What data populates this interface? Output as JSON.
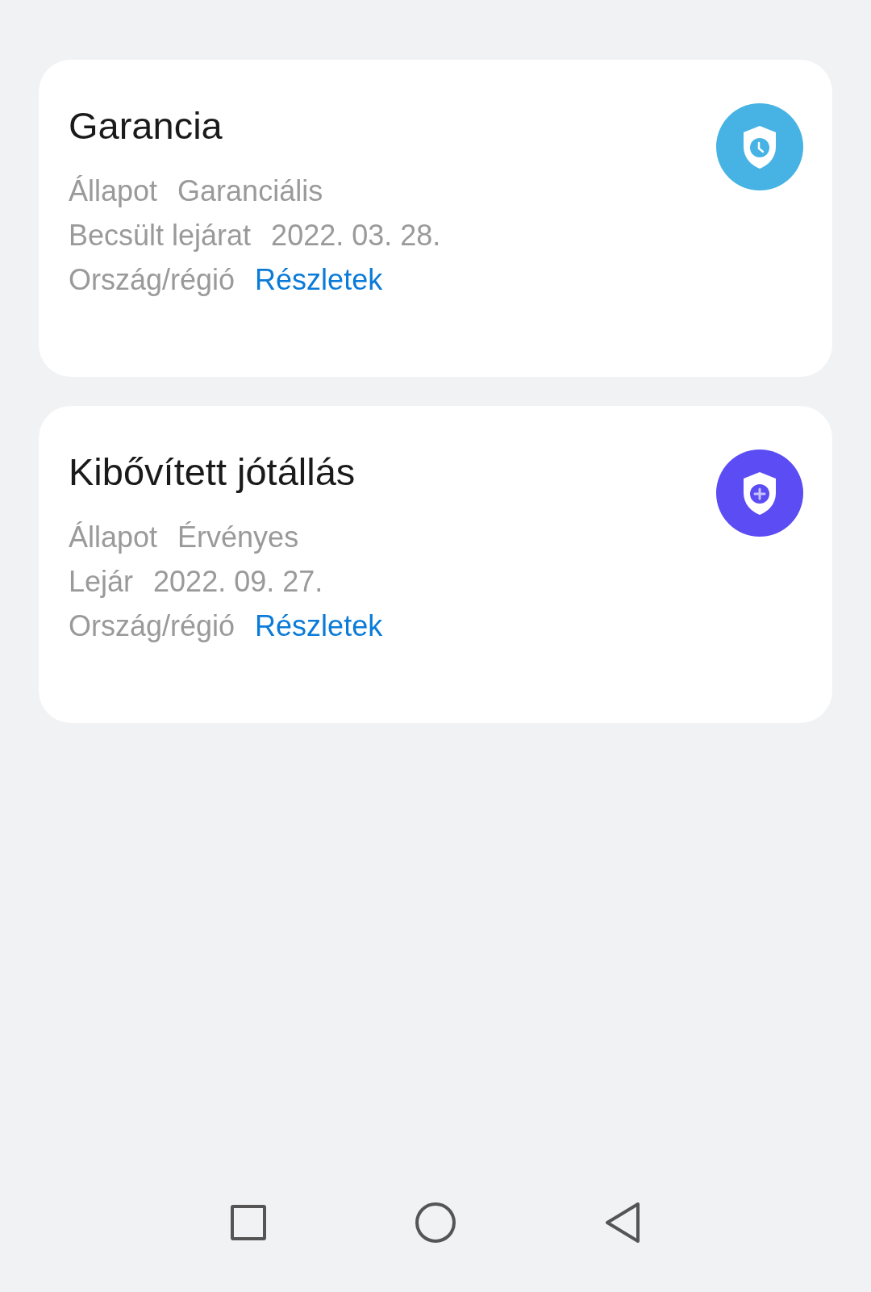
{
  "cards": [
    {
      "title": "Garancia",
      "kind": "clock",
      "color": "#47b3e4",
      "rows": [
        {
          "label": "Állapot",
          "value": "Garanciális",
          "kind": "text"
        },
        {
          "label": "Becsült lejárat",
          "value": "2022. 03. 28.",
          "kind": "text"
        },
        {
          "label": "Ország/régió",
          "value": "Részletek",
          "kind": "link"
        }
      ]
    },
    {
      "title": "Kibővített jótállás",
      "kind": "plus",
      "color": "#5b4cf3",
      "rows": [
        {
          "label": "Állapot",
          "value": "Érvényes",
          "kind": "text"
        },
        {
          "label": "Lejár",
          "value": "2022. 09. 27.",
          "kind": "text"
        },
        {
          "label": "Ország/régió",
          "value": "Részletek",
          "kind": "link"
        }
      ]
    }
  ]
}
